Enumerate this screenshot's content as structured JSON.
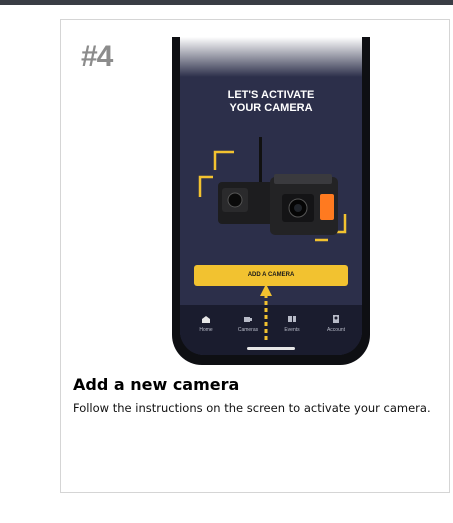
{
  "step_number": "#4",
  "phone_screen": {
    "headline": "LET'S ACTIVATE\nYOUR CAMERA",
    "add_button_label": "ADD A CAMERA",
    "nav": [
      {
        "label": "Home",
        "icon": "home-icon"
      },
      {
        "label": "Cameras",
        "icon": "cameras-icon"
      },
      {
        "label": "Events",
        "icon": "events-icon"
      },
      {
        "label": "Account",
        "icon": "account-icon"
      }
    ]
  },
  "title": "Add a new camera",
  "description": "Follow the instructions on the screen to activate your camera.",
  "colors": {
    "accent": "#f2c230",
    "screen_bg": "#2c2f4a",
    "step_number": "#8c8c8c"
  }
}
